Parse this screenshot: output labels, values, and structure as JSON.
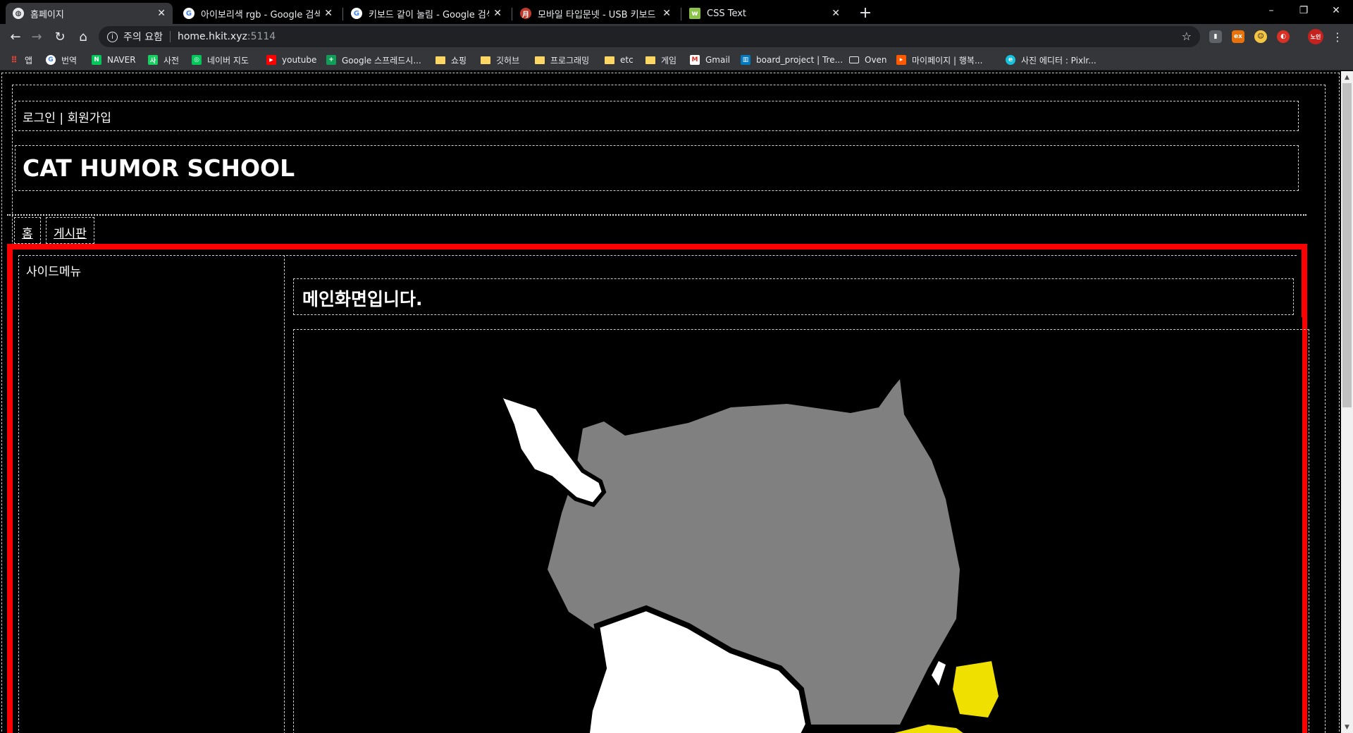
{
  "browser": {
    "tabs": [
      {
        "title": "홈페이지",
        "icon": "globe-icon",
        "active": true
      },
      {
        "title": "아이보리색 rgb - Google 검색",
        "icon": "google-icon",
        "active": false
      },
      {
        "title": "키보드 같이 눌림 - Google 검색",
        "icon": "google-icon",
        "active": false
      },
      {
        "title": "모바일 타입문넷 - USB 키보드 ",
        "icon": "typemoon-icon",
        "active": false
      },
      {
        "title": "CSS Text",
        "icon": "w3schools-icon",
        "active": false
      }
    ],
    "new_tab": "+",
    "window_controls": {
      "minimize": "–",
      "restore": "❐",
      "close": "✕"
    },
    "address": {
      "security_label": "주의 요함",
      "host": "home.hkit.xyz",
      "port": ":5114"
    },
    "extensions": [
      "ext-1-icon",
      "ext-2-icon",
      "ext-3-icon",
      "ext-4-icon"
    ],
    "profile_label": "노인",
    "bookmarks": [
      {
        "label": "앱",
        "icon": "apps-grid-icon"
      },
      {
        "label": "번역",
        "icon": "google-icon"
      },
      {
        "label": "NAVER",
        "icon": "naver-icon"
      },
      {
        "label": "사전",
        "icon": "dictionary-icon"
      },
      {
        "label": "네이버 지도",
        "icon": "map-icon"
      },
      {
        "label": "youtube",
        "icon": "youtube-icon"
      },
      {
        "label": "Google 스프레드시...",
        "icon": "sheets-icon"
      },
      {
        "label": "쇼핑",
        "icon": "folder-icon"
      },
      {
        "label": "깃허브",
        "icon": "folder-icon"
      },
      {
        "label": "프로그래밍",
        "icon": "folder-icon"
      },
      {
        "label": "etc",
        "icon": "folder-icon"
      },
      {
        "label": "게임",
        "icon": "folder-icon"
      },
      {
        "label": "Gmail",
        "icon": "gmail-icon"
      },
      {
        "label": "board_project | Tre...",
        "icon": "trello-icon"
      },
      {
        "label": "Oven",
        "icon": "oven-icon"
      },
      {
        "label": "마이페이지 | 행복...",
        "icon": "happy-icon"
      },
      {
        "label": "사진 에디터 : Pixlr...",
        "icon": "pixlr-icon"
      }
    ]
  },
  "page": {
    "auth": {
      "login": "로그인",
      "separator": " | ",
      "signup": "회원가입"
    },
    "site_title": "CAT HUMOR SCHOOL",
    "nav": [
      {
        "label": "홈"
      },
      {
        "label": "게시판"
      }
    ],
    "sidebar_title": "사이드메뉴",
    "main_heading": "메인화면입니다."
  },
  "colors": {
    "frame_accent": "#ff0000",
    "cat_gray": "#808080",
    "cat_white": "#ffffff",
    "cat_yellow": "#f0e000"
  }
}
